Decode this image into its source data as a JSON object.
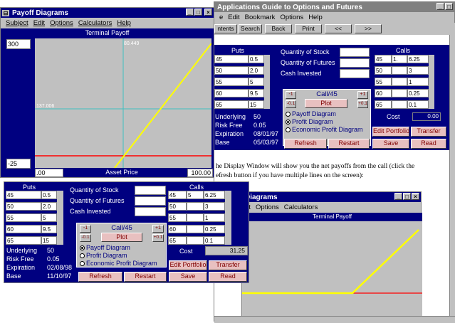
{
  "help_window": {
    "title": "Applications Guide to Options and Futures",
    "menu": [
      "e",
      "Edit",
      "Bookmark",
      "Options",
      "Help"
    ],
    "buttons": [
      "ntents",
      "Search",
      "Back",
      "Print",
      "<<",
      ">>"
    ],
    "body_text_line1": "he Display Window will show you the net payoffs from the call (click the",
    "body_text_line2": "efresh button if you have multiple lines on the screen):",
    "inner_window": {
      "title": "Diagrams",
      "menu": [
        "dit",
        "Options",
        "Calculators"
      ],
      "chart_title": "Terminal Payoff"
    },
    "calc": {
      "puts_header": "Puts",
      "calls_header": "Calls",
      "put_strikes": [
        "45",
        "50",
        "55",
        "60",
        "65"
      ],
      "put_prices": [
        "0.5",
        "2.0",
        "5",
        "9.5",
        "15"
      ],
      "call_strikes": [
        "45",
        "50",
        "55",
        "60",
        "65"
      ],
      "call_qty": [
        "1.",
        "",
        "",
        "",
        ""
      ],
      "call_prices": [
        "6.25",
        "3",
        "1",
        "0.25",
        "0.1"
      ],
      "quantity_stock": "Quantity of Stock",
      "quantity_futures": "Quantity of Futures",
      "cash_invested": "Cash Invested",
      "option_title": "Call/45",
      "minus1": "-1",
      "plus1": "+1",
      "minus01": "-0.1",
      "plus01": "+0.1",
      "plot": "Plot",
      "radio_payoff": "Payoff Diagram",
      "radio_profit": "Profit Diagram",
      "radio_econ": "Economic Profit Diagram",
      "underlying_label": "Underlying",
      "underlying": "50",
      "riskfree_label": "Risk Free",
      "riskfree": "0.05",
      "expiration_label": "Expiration",
      "expiration": "08/01/97",
      "base_label": "Base",
      "base": "05/03/97",
      "cost_label": "Cost",
      "cost": "0.00",
      "edit_portfolio": "Edit Portfolio",
      "transfer": "Transfer",
      "refresh": "Refresh",
      "restart": "Restart",
      "save": "Save",
      "read": "Read"
    }
  },
  "payoff_window": {
    "title": "Payoff Diagrams",
    "menu": [
      "Subject",
      "Edit",
      "Options",
      "Calculators",
      "Help"
    ],
    "chart_title": "Terminal Payoff",
    "y_max": "300",
    "y_min": "-25",
    "x_min": ".00",
    "x_max": "100.00",
    "x_label": "Asset Price",
    "crosshair_x": "80.449",
    "crosshair_y": "137.006",
    "colors": {
      "bg": "#c0c0c0",
      "payoff": "#ffff00",
      "zero": "#ff0000",
      "cross": "#40c0c0"
    }
  },
  "calc2": {
    "puts_header": "Puts",
    "calls_header": "Calls",
    "put_strikes": [
      "45",
      "50",
      "55",
      "60",
      "65"
    ],
    "put_prices": [
      "0.5",
      "2.0",
      "5",
      "9.5",
      "15"
    ],
    "call_strikes": [
      "45",
      "50",
      "55",
      "60",
      "65"
    ],
    "call_qty": [
      "5",
      "",
      "",
      "",
      ""
    ],
    "call_prices": [
      "6.25",
      "3",
      "1",
      "0.25",
      "0.1"
    ],
    "quantity_stock": "Quantity of Stock",
    "quantity_futures": "Quantity of Futures",
    "cash_invested": "Cash Invested",
    "option_title": "Call/45",
    "minus1": "-1",
    "plus1": "+1",
    "minus01": "-0.1",
    "plus01": "+0.1",
    "plot": "Plot",
    "radio_payoff": "Payoff Diagram",
    "radio_profit": "Profit Diagram",
    "radio_econ": "Economic Profit Diagram",
    "underlying_label": "Underlying",
    "underlying": "50",
    "riskfree_label": "Risk Free",
    "riskfree": "0.05",
    "expiration_label": "Expiration",
    "expiration": "02/08/98",
    "base_label": "Base",
    "base": "11/10/97",
    "cost_label": "Cost",
    "cost": "31.25",
    "edit_portfolio": "Edit Portfolio",
    "transfer": "Transfer",
    "refresh": "Refresh",
    "restart": "Restart",
    "save": "Save",
    "read": "Read"
  }
}
